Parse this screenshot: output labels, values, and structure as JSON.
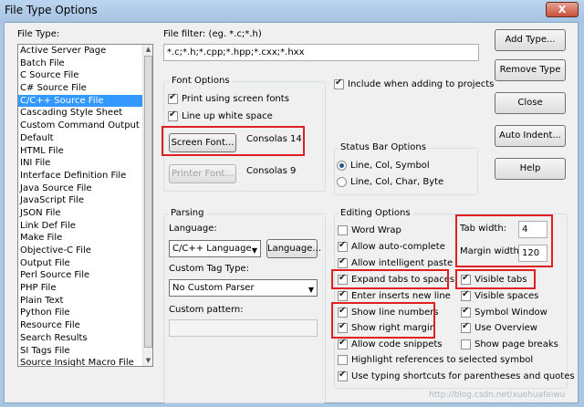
{
  "window": {
    "title": "File Type Options",
    "close_glyph": "X"
  },
  "file_type": {
    "label": "File Type:",
    "items": [
      "Active Server Page",
      "Batch File",
      "C Source File",
      "C# Source File",
      "C/C++ Source File",
      "Cascading Style Sheet",
      "Custom Command Output",
      "Default",
      "HTML File",
      "INI File",
      "Interface Definition File",
      "Java Source File",
      "JavaScript File",
      "JSON File",
      "Link Def File",
      "Make File",
      "Objective-C File",
      "Output File",
      "Perl Source File",
      "PHP File",
      "Plain Text",
      "Python File",
      "Resource File",
      "Search Results",
      "SI Tags File",
      "Source Insight Macro File"
    ],
    "selected": "C/C++ Source File"
  },
  "file_filter": {
    "label": "File filter: (eg. *.c;*.h)",
    "value": "*.c;*.h;*.cpp;*.hpp;*.cxx;*.hxx"
  },
  "buttons": {
    "add_type": "Add Type...",
    "remove_type": "Remove Type",
    "close": "Close",
    "auto_indent": "Auto Indent...",
    "help": "Help"
  },
  "font_options": {
    "title": "Font Options",
    "print_screen_fonts": "Print using screen fonts",
    "line_up_white_space": "Line up white space",
    "screen_font_button": "Screen Font...",
    "screen_font_value": "Consolas 14",
    "printer_font_button": "Printer Font...",
    "printer_font_value": "Consolas 9"
  },
  "include_projects": "Include when adding to projects",
  "status_bar": {
    "title": "Status Bar Options",
    "opt1": "Line, Col, Symbol",
    "opt2": "Line, Col, Char, Byte"
  },
  "parsing": {
    "title": "Parsing",
    "language_label": "Language:",
    "language_value": "C/C++ Language",
    "language_button": "Language...",
    "custom_tag_label": "Custom Tag Type:",
    "custom_tag_value": "No Custom Parser",
    "custom_pattern_label": "Custom pattern:"
  },
  "editing": {
    "title": "Editing Options",
    "word_wrap": "Word Wrap",
    "allow_auto_complete": "Allow auto-complete",
    "allow_intelligent_paste": "Allow intelligent paste",
    "expand_tabs": "Expand tabs to spaces",
    "enter_inserts_new_line": "Enter inserts new line",
    "show_line_numbers": "Show line numbers",
    "show_right_margin": "Show right margin",
    "allow_code_snippets": "Allow code snippets",
    "highlight_references": "Highlight references to selected symbol",
    "typing_shortcuts": "Use typing shortcuts for parentheses and quotes",
    "tab_width_label": "Tab width:",
    "tab_width_value": "4",
    "margin_width_label": "Margin width:",
    "margin_width_value": "120",
    "visible_tabs": "Visible tabs",
    "visible_spaces": "Visible spaces",
    "symbol_window": "Symbol Window",
    "use_overview": "Use Overview",
    "show_page_breaks": "Show page breaks"
  },
  "watermark": "http://blog.csdn.net/xuehuafeiwu",
  "colors": {
    "highlight": "#e02020",
    "selection": "#3399ff"
  }
}
